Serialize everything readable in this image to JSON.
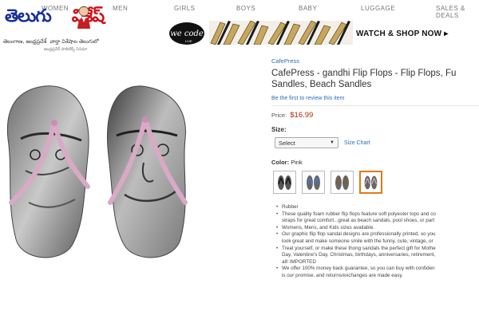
{
  "nav": {
    "items": [
      "WOMEN",
      "MEN",
      "GIRLS",
      "BOYS",
      "BABY",
      "LUGGAGE",
      "SALES & DEALS"
    ]
  },
  "logo": {
    "main_blue": "తెలుగు",
    "main_red": "విశేష్",
    "tagline": "తెలంగాణ, ఆంధ్రప్రదేశ్",
    "tagline_right": "వార్తా విశేషాల తెలుగులో",
    "tagline_small": "ఆంధ్రప్రదేశ్ పాలిటిక్స్ సినిమా"
  },
  "ad": {
    "brand": "we code",
    "brand_sub": "LIVE",
    "cta": "WATCH & SHOP NOW ▸"
  },
  "product": {
    "brand": "CafePress",
    "title_line1": "CafePress - gandhi Flip Flops - Flip Flops, Fu",
    "title_line2": "Sandles, Beach Sandles",
    "review_link": "Be the first to review this item",
    "price_label": "Price:",
    "price_value": "$16.99",
    "size_label": "Size:",
    "size_select": "Select",
    "size_chart": "Size Chart",
    "color_label": "Color:",
    "color_value": "Pink",
    "swatches": [
      "black",
      "blue",
      "brown",
      "pink"
    ],
    "bullets": [
      "Rubber",
      "These quality foam rubber flip flops feature soft polyester tops and co",
      "straps for great comfort...great as beach sandals, pool shoes, or part",
      "Womens, Mens, and Kids sizes available.",
      "Our graphic flip flop sandal designs are professionally printed, so you",
      "look great and make someone smile with the funny, cute, vintage, or",
      "Treat yourself, or make these thong sandals the perfect gift for Mothe",
      "Day, Valentine's Day, Christmas, birthdays, anniversaries, retirement,",
      "all! IMPORTED",
      "We offer 100% money back guarantee, so you can buy with confiden",
      "is our promise, and returns/exchanges are made easy."
    ]
  },
  "colors": {
    "link": "#2a6ebb",
    "price": "#b12704",
    "logo_blue": "#1a2f9a",
    "logo_red": "#d0121b",
    "strap_pink": "#d9a9c6",
    "selected": "#e47911"
  }
}
